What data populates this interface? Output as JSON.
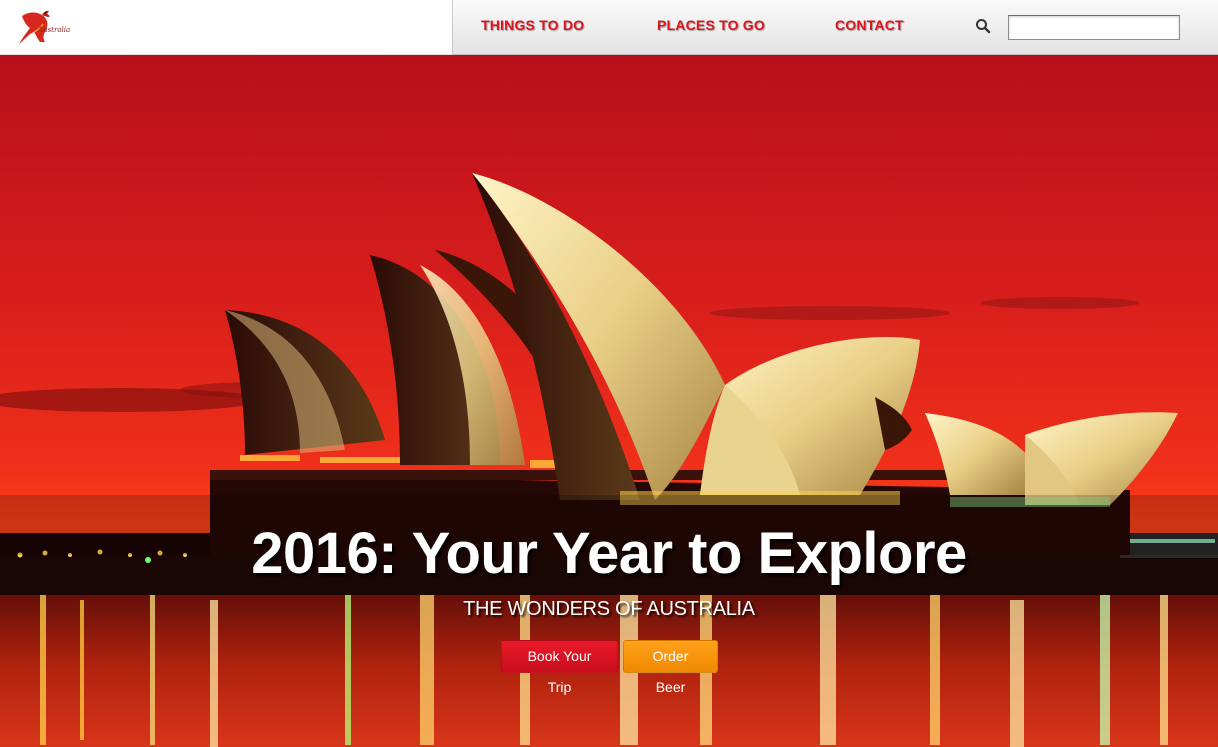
{
  "header": {
    "logo_text": "Australia",
    "nav": [
      {
        "label": "THINGS TO DO"
      },
      {
        "label": "PLACES TO GO"
      },
      {
        "label": "CONTACT"
      }
    ],
    "search": {
      "value": "",
      "placeholder": ""
    }
  },
  "hero": {
    "title": "2016: Your Year to Explore",
    "subtitle": "THE WONDERS OF AUSTRALIA",
    "buttons": {
      "book": "Book Your Trip",
      "order": "Order Beer"
    }
  },
  "colors": {
    "accent_red": "#e0141e",
    "button_red": "#d3121f",
    "button_orange": "#f5940a",
    "sky_top": "#c3121a",
    "sky_horizon": "#ff3a10"
  },
  "icons": [
    "kangaroo-logo-icon",
    "search-icon"
  ]
}
